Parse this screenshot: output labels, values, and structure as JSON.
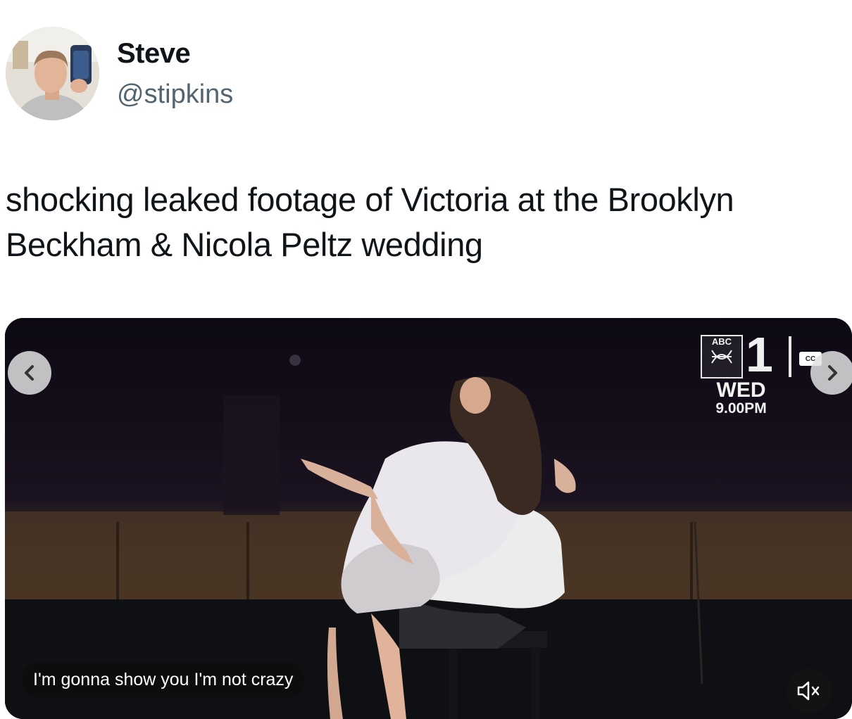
{
  "author": {
    "name": "Steve",
    "handle": "@stipkins",
    "avatar_icon": "profile-photo"
  },
  "tweet": {
    "text": "shocking leaked footage of Victoria at the Brooklyn Beckham & Nicola Peltz wedding"
  },
  "media": {
    "caption": "I'm gonna show you I'm not crazy",
    "prev_icon": "chevron-left-icon",
    "next_icon": "chevron-right-icon",
    "mute_icon": "speaker-muted-icon",
    "cc_label": "CC",
    "channel_logo": {
      "brand": "ABC",
      "channel_number": "1",
      "day": "WED",
      "time": "9.00PM"
    }
  },
  "colors": {
    "text_primary": "#0f1419",
    "text_secondary": "#536471",
    "video_background": "#0e0a14"
  }
}
